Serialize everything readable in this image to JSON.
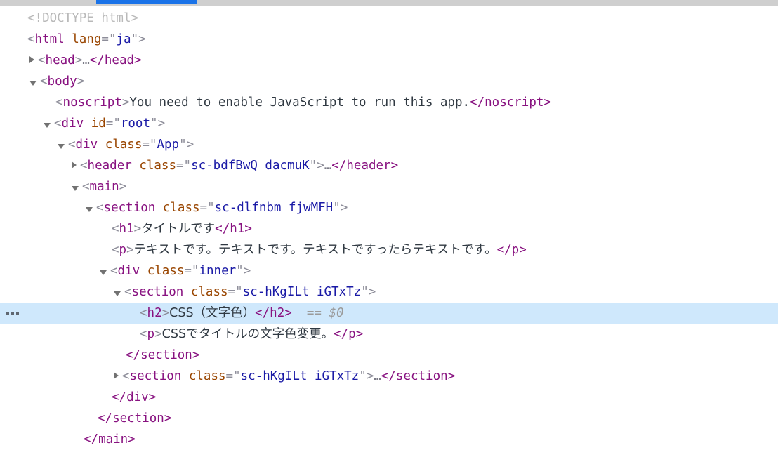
{
  "window": {
    "app": "Chrome DevTools",
    "panel": "Elements",
    "accent_color": "#1a73e8",
    "selection_color": "#cfe8fc",
    "topbar_color": "#cfcfcf"
  },
  "tokens": {
    "tag_color": "#881280",
    "attr_name_color": "#994500",
    "attr_value_color": "#1a1aa6",
    "text_color": "#303942",
    "punct_color": "#8d8d99",
    "doctype_color": "#b9b9b9",
    "ref_color": "#9a9a9a"
  },
  "selected_node_ref": "$0",
  "gutter_badge": "···",
  "tree": {
    "rows": [
      {
        "id": "row-doctype",
        "indent": 0,
        "twisty": "none",
        "selected": false,
        "doctype": "<!DOCTYPE html>"
      },
      {
        "id": "row-html-open",
        "indent": 0,
        "twisty": "none",
        "selected": false,
        "lt": "<",
        "tag": "html",
        "space": " ",
        "attr_name": "lang",
        "eq_q1": "=\"",
        "attr_value": "ja",
        "q2": "\"",
        "gt": ">"
      },
      {
        "id": "row-head",
        "indent": 1,
        "twisty": "closed",
        "selected": false,
        "lt": "<",
        "tag": "head",
        "gt": ">",
        "ellipsis": "…",
        "close": "</head>"
      },
      {
        "id": "row-body-open",
        "indent": 1,
        "twisty": "open",
        "selected": false,
        "lt": "<",
        "tag": "body",
        "gt": ">"
      },
      {
        "id": "row-noscript",
        "indent": 2,
        "twisty": "none",
        "selected": false,
        "lt": "<",
        "tag": "noscript",
        "gt": ">",
        "text": "You need to enable JavaScript to run this app.",
        "close": "</noscript>"
      },
      {
        "id": "row-div-root",
        "indent": 2,
        "twisty": "open",
        "selected": false,
        "lt": "<",
        "tag": "div",
        "space": " ",
        "attr_name": "id",
        "eq_q1": "=\"",
        "attr_value": "root",
        "q2": "\"",
        "gt": ">"
      },
      {
        "id": "row-div-app",
        "indent": 3,
        "twisty": "open",
        "selected": false,
        "lt": "<",
        "tag": "div",
        "space": " ",
        "attr_name": "class",
        "eq_q1": "=\"",
        "attr_value": "App",
        "q2": "\"",
        "gt": ">"
      },
      {
        "id": "row-header",
        "indent": 4,
        "twisty": "closed",
        "selected": false,
        "lt": "<",
        "tag": "header",
        "space": " ",
        "attr_name": "class",
        "eq_q1": "=\"",
        "attr_value": "sc-bdfBwQ dacmuK",
        "q2": "\"",
        "gt": ">",
        "ellipsis": "…",
        "close": "</header>"
      },
      {
        "id": "row-main-open",
        "indent": 4,
        "twisty": "open",
        "selected": false,
        "lt": "<",
        "tag": "main",
        "gt": ">"
      },
      {
        "id": "row-section-outer",
        "indent": 5,
        "twisty": "open",
        "selected": false,
        "lt": "<",
        "tag": "section",
        "space": " ",
        "attr_name": "class",
        "eq_q1": "=\"",
        "attr_value": "sc-dlfnbm fjwMFH",
        "q2": "\"",
        "gt": ">"
      },
      {
        "id": "row-h1",
        "indent": 6,
        "twisty": "none",
        "selected": false,
        "lt": "<",
        "tag": "h1",
        "gt": ">",
        "text": "タイトルです",
        "close": "</h1>"
      },
      {
        "id": "row-p-lead",
        "indent": 6,
        "twisty": "none",
        "selected": false,
        "lt": "<",
        "tag": "p",
        "gt": ">",
        "text": "テキストです。テキストです。テキストですったらテキストです。",
        "close": "</p>"
      },
      {
        "id": "row-div-inner",
        "indent": 6,
        "twisty": "open",
        "selected": false,
        "lt": "<",
        "tag": "div",
        "space": " ",
        "attr_name": "class",
        "eq_q1": "=\"",
        "attr_value": "inner",
        "q2": "\"",
        "gt": ">"
      },
      {
        "id": "row-section-inner-1",
        "indent": 7,
        "twisty": "open",
        "selected": false,
        "lt": "<",
        "tag": "section",
        "space": " ",
        "attr_name": "class",
        "eq_q1": "=\"",
        "attr_value": "sc-hKgILt iGTxTz",
        "q2": "\"",
        "gt": ">"
      },
      {
        "id": "row-h2-selected",
        "indent": 8,
        "twisty": "none",
        "selected": true,
        "lt": "<",
        "tag": "h2",
        "gt": ">",
        "text": "CSS（文字色）",
        "close": "</h2>",
        "eq_marker": "==",
        "node_ref": "$0"
      },
      {
        "id": "row-p-css",
        "indent": 8,
        "twisty": "none",
        "selected": false,
        "lt": "<",
        "tag": "p",
        "gt": ">",
        "text": "CSSでタイトルの文字色変更。",
        "close": "</p>"
      },
      {
        "id": "row-section-inner-1-close",
        "indent": 7,
        "twisty": "none",
        "selected": false,
        "close": "</section>"
      },
      {
        "id": "row-section-inner-2",
        "indent": 7,
        "twisty": "closed",
        "selected": false,
        "lt": "<",
        "tag": "section",
        "space": " ",
        "attr_name": "class",
        "eq_q1": "=\"",
        "attr_value": "sc-hKgILt iGTxTz",
        "q2": "\"",
        "gt": ">",
        "ellipsis": "…",
        "close": "</section>"
      },
      {
        "id": "row-div-inner-close",
        "indent": 6,
        "twisty": "none",
        "selected": false,
        "close": "</div>"
      },
      {
        "id": "row-section-outer-close",
        "indent": 5,
        "twisty": "none",
        "selected": false,
        "close": "</section>"
      },
      {
        "id": "row-main-close",
        "indent": 4,
        "twisty": "none",
        "selected": false,
        "close": "</main>"
      }
    ]
  }
}
